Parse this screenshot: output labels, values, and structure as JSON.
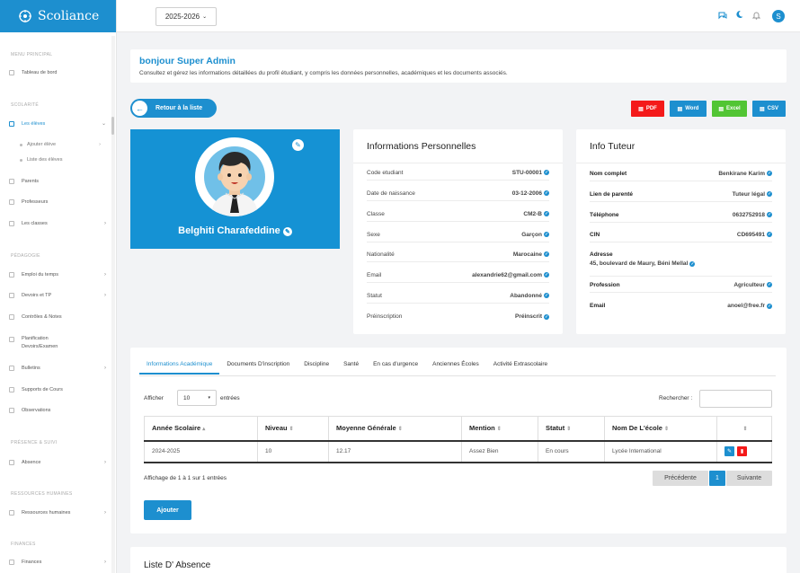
{
  "brand": {
    "name": "Scoliance"
  },
  "sidebar": {
    "sections": [
      "MENU PRINCIPAL",
      "SCOLARITÉ",
      "PÉDAGOGIE",
      "PRÉSENCE & SUIVI",
      "RESSOURCES HUMAINES",
      "FINANCES"
    ],
    "items": [
      {
        "label": "Tableau de bord"
      },
      {
        "label": "Les élèves"
      },
      {
        "label": "Ajouter élève"
      },
      {
        "label": "Liste des élèves"
      },
      {
        "label": "Parents"
      },
      {
        "label": "Professeurs"
      },
      {
        "label": "Les classes"
      },
      {
        "label": "Emploi du temps"
      },
      {
        "label": "Devoirs et TP"
      },
      {
        "label": "Contrôles & Notes"
      },
      {
        "label": "Planification Devoirs/Examen"
      },
      {
        "label": "Bulletins"
      },
      {
        "label": "Supports de Cours"
      },
      {
        "label": "Observations"
      },
      {
        "label": "Absence"
      },
      {
        "label": "Ressources humaines"
      },
      {
        "label": "Finances"
      }
    ]
  },
  "topbar": {
    "year": "2025-2026",
    "user_initial": "S"
  },
  "welcome": {
    "title": "bonjour Super Admin",
    "subtitle": "Consultez et gérez les informations détaillées du profil étudiant, y compris les données personnelles, académiques et les documents associés."
  },
  "actions": {
    "back": "Retour à la liste",
    "pdf": "PDF",
    "word": "Word",
    "excel": "Excel",
    "csv": "CSV"
  },
  "profile": {
    "name": "Belghiti Charafeddine"
  },
  "personal": {
    "title": "Informations Personnelles",
    "rows": [
      {
        "k": "Code etudiant",
        "v": "STU-00001"
      },
      {
        "k": "Date de naissance",
        "v": "03-12-2006"
      },
      {
        "k": "Classe",
        "v": "CM2-B"
      },
      {
        "k": "Sexe",
        "v": "Garçon"
      },
      {
        "k": "Nationalité",
        "v": "Marocaine"
      },
      {
        "k": "Email",
        "v": "alexandrie62@gmail.com"
      },
      {
        "k": "Statut",
        "v": "Abandonné"
      },
      {
        "k": "Préinscription",
        "v": "Préinscrit"
      }
    ]
  },
  "tutor": {
    "title": "Info Tuteur",
    "rows": [
      {
        "k": "Nom complet",
        "v": "Benkirane Karim"
      },
      {
        "k": "Lien de parenté",
        "v": "Tuteur légal"
      },
      {
        "k": "Téléphone",
        "v": "0632752918"
      },
      {
        "k": "CIN",
        "v": "CD695491"
      }
    ],
    "address_label": "Adresse",
    "address": "45, boulevard de Maury, Béni Mellal",
    "rows2": [
      {
        "k": "Profession",
        "v": "Agriculteur"
      },
      {
        "k": "Email",
        "v": "anoel@free.fr"
      }
    ]
  },
  "tabs": [
    "Informations Académique",
    "Documents D'inscription",
    "Discipline",
    "Santé",
    "En cas d'urgence",
    "Anciennes Écoles",
    "Activité Extrascolaire"
  ],
  "table": {
    "show": "Afficher",
    "entries_value": "10",
    "entries": "entrées",
    "search": "Rechercher :",
    "headers": [
      "Année Scolaire",
      "Niveau",
      "Moyenne Générale",
      "Mention",
      "Statut",
      "Nom De L'école",
      ""
    ],
    "rows": [
      [
        "2024-2025",
        "10",
        "12.17",
        "Assez Bien",
        "En cours",
        "Lycée International"
      ]
    ],
    "info": "Affichage de 1 à 1 sur 1 entrées",
    "prev": "Précédente",
    "page": "1",
    "next": "Suivante",
    "add": "Ajouter"
  },
  "absence": {
    "title": "Liste D' Absence"
  }
}
